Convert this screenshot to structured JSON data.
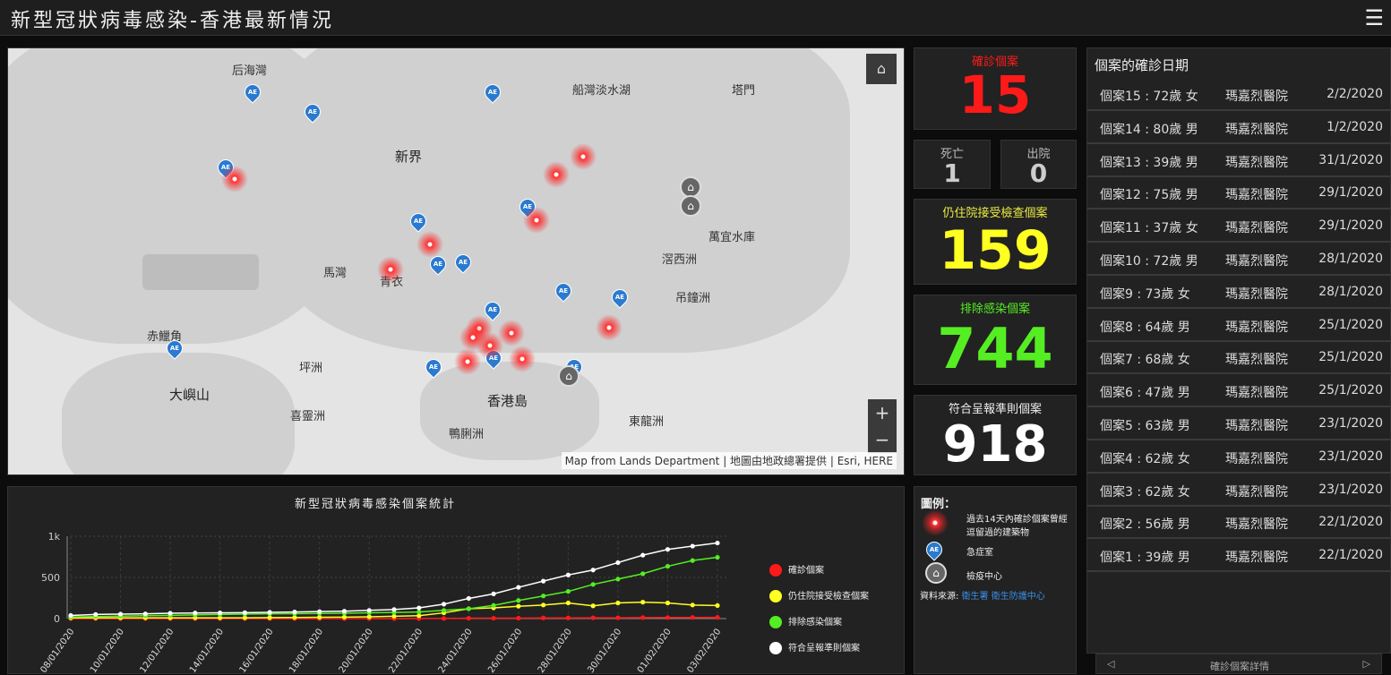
{
  "header": {
    "title": "新型冠狀病毒感染-香港最新情況",
    "menu_icon": "hamburger-icon"
  },
  "map": {
    "places": [
      "后海灣",
      "船灣淡水湖",
      "塔門",
      "新界",
      "萬宜水庫",
      "馬灣",
      "青衣",
      "滘西洲",
      "吊鐘洲",
      "赤鱲角",
      "坪洲",
      "大嶼山",
      "香港島",
      "喜靈洲",
      "東龍洲",
      "鴨脷洲"
    ],
    "ae_label": "AE",
    "attribution": "Map from Lands Department | 地圖由地政總署提供 | Esri, HERE",
    "zoom_in": "+",
    "zoom_out": "−"
  },
  "stats": {
    "confirmed": {
      "label": "確診個案",
      "value": "15",
      "color": "#ff1a1a"
    },
    "death": {
      "label": "死亡",
      "value": "1"
    },
    "discharged": {
      "label": "出院",
      "value": "0"
    },
    "hospitalised": {
      "label": "仍住院接受檢查個案",
      "value": "159",
      "color": "#ffff22"
    },
    "excluded": {
      "label": "排除感染個案",
      "value": "744",
      "color": "#55ee22"
    },
    "reported": {
      "label": "符合呈報準則個案",
      "value": "918",
      "color": "#ffffff"
    }
  },
  "legend": {
    "title": "圖例：",
    "items": [
      "過去14天內確診個案曾經逗留過的建築物",
      "急症室",
      "檢疫中心"
    ],
    "source_label": "資料來源:",
    "source_links": [
      "衛生署 衛生防護中心"
    ]
  },
  "cases": {
    "title": "個案的確診日期",
    "footer": "確診個案詳情",
    "rows": [
      {
        "case": "個案15 : 72歲 女",
        "hospital": "瑪嘉烈醫院",
        "date": "2/2/2020"
      },
      {
        "case": "個案14 : 80歲 男",
        "hospital": "瑪嘉烈醫院",
        "date": "1/2/2020"
      },
      {
        "case": "個案13 : 39歲 男",
        "hospital": "瑪嘉烈醫院",
        "date": "31/1/2020"
      },
      {
        "case": "個案12 : 75歲 男",
        "hospital": "瑪嘉烈醫院",
        "date": "29/1/2020"
      },
      {
        "case": "個案11 : 37歲 女",
        "hospital": "瑪嘉烈醫院",
        "date": "29/1/2020"
      },
      {
        "case": "個案10 : 72歲 男",
        "hospital": "瑪嘉烈醫院",
        "date": "28/1/2020"
      },
      {
        "case": "個案9 : 73歲 女",
        "hospital": "瑪嘉烈醫院",
        "date": "28/1/2020"
      },
      {
        "case": "個案8 : 64歲 男",
        "hospital": "瑪嘉烈醫院",
        "date": "25/1/2020"
      },
      {
        "case": "個案7 : 68歲 女",
        "hospital": "瑪嘉烈醫院",
        "date": "25/1/2020"
      },
      {
        "case": "個案6 : 47歲 男",
        "hospital": "瑪嘉烈醫院",
        "date": "25/1/2020"
      },
      {
        "case": "個案5 : 63歲 男",
        "hospital": "瑪嘉烈醫院",
        "date": "23/1/2020"
      },
      {
        "case": "個案4 : 62歲 女",
        "hospital": "瑪嘉烈醫院",
        "date": "23/1/2020"
      },
      {
        "case": "個案3 : 62歲 女",
        "hospital": "瑪嘉烈醫院",
        "date": "23/1/2020"
      },
      {
        "case": "個案2 : 56歲 男",
        "hospital": "瑪嘉烈醫院",
        "date": "22/1/2020"
      },
      {
        "case": "個案1 : 39歲 男",
        "hospital": "瑪嘉烈醫院",
        "date": "22/1/2020"
      }
    ]
  },
  "chart_data": {
    "type": "line",
    "title": "新型冠狀病毒感染個案統計",
    "x": [
      "08/01/2020",
      "09/01/2020",
      "10/01/2020",
      "11/01/2020",
      "12/01/2020",
      "13/01/2020",
      "14/01/2020",
      "15/01/2020",
      "16/01/2020",
      "17/01/2020",
      "18/01/2020",
      "19/01/2020",
      "20/01/2020",
      "21/01/2020",
      "22/01/2020",
      "23/01/2020",
      "24/01/2020",
      "25/01/2020",
      "26/01/2020",
      "27/01/2020",
      "28/01/2020",
      "29/01/2020",
      "30/01/2020",
      "31/01/2020",
      "01/02/2020",
      "02/02/2020",
      "03/02/2020"
    ],
    "xticks": [
      "08/01/2020",
      "10/01/2020",
      "12/01/2020",
      "14/01/2020",
      "16/01/2020",
      "18/01/2020",
      "20/01/2020",
      "22/01/2020",
      "24/01/2020",
      "26/01/2020",
      "28/01/2020",
      "30/01/2020",
      "01/02/2020",
      "03/02/2020"
    ],
    "yticks": [
      "0",
      "500",
      "1k"
    ],
    "ylim": [
      0,
      1000
    ],
    "legend_position": "right",
    "series": [
      {
        "name": "確診個案",
        "color": "#ff1a1a",
        "values": [
          0,
          0,
          0,
          0,
          0,
          0,
          0,
          0,
          0,
          0,
          0,
          0,
          0,
          0,
          1,
          2,
          5,
          5,
          6,
          8,
          8,
          10,
          10,
          12,
          13,
          14,
          15
        ]
      },
      {
        "name": "仍住院接受檢查個案",
        "color": "#ffff22",
        "values": [
          10,
          10,
          10,
          10,
          10,
          10,
          10,
          10,
          12,
          14,
          16,
          18,
          22,
          28,
          35,
          70,
          120,
          130,
          150,
          165,
          190,
          155,
          190,
          200,
          190,
          165,
          159
        ]
      },
      {
        "name": "排除感染個案",
        "color": "#55ee22",
        "values": [
          20,
          25,
          30,
          35,
          40,
          45,
          50,
          55,
          58,
          60,
          62,
          65,
          70,
          75,
          80,
          100,
          120,
          160,
          220,
          275,
          330,
          415,
          480,
          545,
          635,
          705,
          744
        ]
      },
      {
        "name": "符合呈報準則個案",
        "color": "#ffffff",
        "values": [
          38,
          50,
          55,
          58,
          65,
          68,
          70,
          72,
          76,
          80,
          85,
          90,
          100,
          110,
          130,
          175,
          245,
          300,
          380,
          455,
          530,
          590,
          680,
          770,
          840,
          880,
          918
        ]
      }
    ]
  }
}
